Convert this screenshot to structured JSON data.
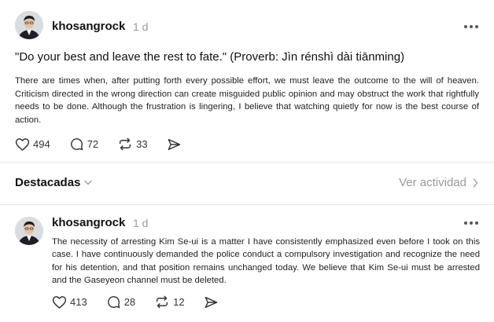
{
  "posts": [
    {
      "username": "khosangrock",
      "time": "1 d",
      "quote": "\"Do your best and leave the rest to fate.\" (Proverb: Jìn rénshì dài tiānming)",
      "body": "There are times when, after putting forth every possible effort, we must leave the outcome to the will of heaven. Criticism directed in the wrong direction can create misguided public opinion and may obstruct the work that rightfully needs to be done. Although the frustration is lingering, I believe that watching quietly for now is the best course of action.",
      "likes": "494",
      "replies": "72",
      "reposts": "33"
    },
    {
      "username": "khosangrock",
      "time": "1 d",
      "body": "The necessity of arresting Kim Se-ui is a matter I have consistently emphasized even before I took on this case. I have continuously demanded the police conduct a compulsory investigation and recognize the need for his detention, and that position remains unchanged today. We believe that Kim Se-ui must be arrested and the Gaseyeon channel must be deleted.",
      "likes": "413",
      "replies": "28",
      "reposts": "12"
    }
  ],
  "tabs": {
    "destacadas": "Destacadas",
    "ver_actividad": "Ver actividad"
  },
  "icons": {
    "like": "heart-icon",
    "reply": "comment-icon",
    "repost": "repost-icon",
    "share": "send-icon",
    "more": "more-dots-icon"
  },
  "colors": {
    "text": "#111111",
    "muted": "#9a9a9a",
    "divider": "#e6e6e6"
  }
}
